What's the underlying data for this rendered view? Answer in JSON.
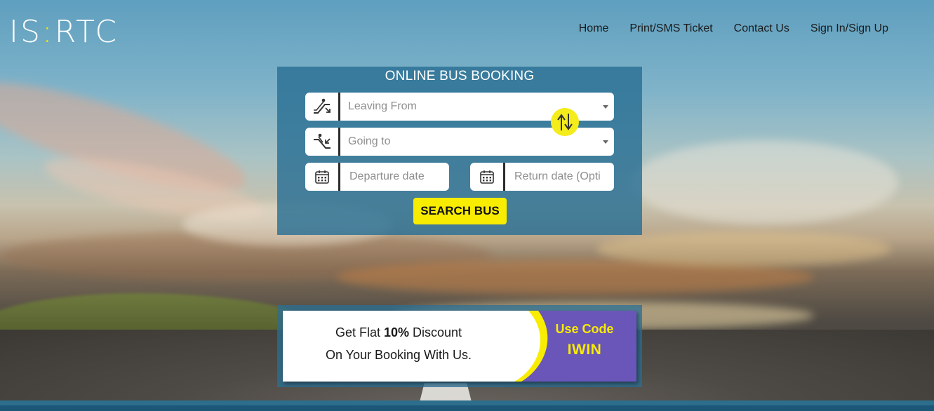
{
  "header": {
    "logo_text": "ISRTC",
    "logo_parts": {
      "a": "IS",
      "dots": ":",
      "b": "RTC"
    },
    "nav": [
      {
        "label": "Home"
      },
      {
        "label": "Print/SMS Ticket"
      },
      {
        "label": "Contact Us"
      },
      {
        "label": "Sign In/Sign Up"
      }
    ]
  },
  "booking": {
    "title": "ONLINE BUS BOOKING",
    "leaving_from_placeholder": "Leaving From",
    "going_to_placeholder": "Going to",
    "departure_placeholder": "Departure date",
    "return_placeholder": "Return date (Opti",
    "search_button": "SEARCH BUS",
    "icons": {
      "from": "escalator-up-icon",
      "to": "escalator-down-icon",
      "calendar": "calendar-icon",
      "swap": "swap-arrows-icon"
    }
  },
  "promo": {
    "line1_prefix": "Get Flat ",
    "line1_bold": "10%",
    "line1_suffix": " Discount",
    "line2": "On Your Booking With Us.",
    "code_label": "Use Code",
    "code": "IWIN"
  },
  "colors": {
    "accent_yellow": "#f8ec00",
    "panel_blue": "#2a6f94",
    "promo_purple": "#6a55b8"
  }
}
